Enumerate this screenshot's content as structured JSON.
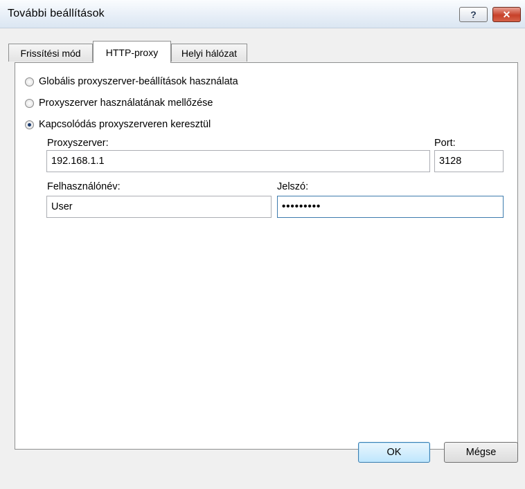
{
  "window": {
    "title": "További beállítások",
    "help_label": "?",
    "close_label": "✕"
  },
  "tabs": [
    {
      "label": "Frissítési mód"
    },
    {
      "label": "HTTP-proxy"
    },
    {
      "label": "Helyi hálózat"
    }
  ],
  "radios": [
    {
      "label": "Globális proxyszerver-beállítások használata",
      "selected": false
    },
    {
      "label": "Proxyszerver használatának mellőzése",
      "selected": false
    },
    {
      "label": "Kapcsolódás proxyszerveren keresztül",
      "selected": true
    }
  ],
  "fields": {
    "proxy_label": "Proxyszerver:",
    "proxy_value": "192.168.1.1",
    "port_label": "Port:",
    "port_value": "3128",
    "user_label": "Felhasználónév:",
    "user_value": "User",
    "password_label": "Jelszó:",
    "password_value": "•••••••••"
  },
  "buttons": {
    "ok": "OK",
    "cancel": "Mégse"
  }
}
